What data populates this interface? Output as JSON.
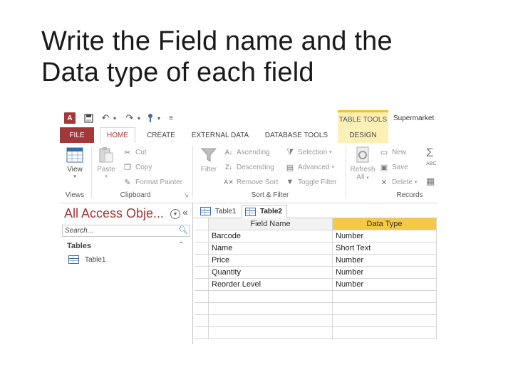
{
  "slide": {
    "title_line1": "Write the Field name and the",
    "title_line2": "Data type of each field"
  },
  "window": {
    "app_name": "Supermarket",
    "contextual_tab_group": "TABLE TOOLS",
    "access_logo": "A"
  },
  "tabs": [
    "FILE",
    "HOME",
    "CREATE",
    "EXTERNAL DATA",
    "DATABASE TOOLS",
    "DESIGN"
  ],
  "ribbon": {
    "views": {
      "view_label": "View",
      "group_label": "Views"
    },
    "clipboard": {
      "paste_label": "Paste",
      "cut_label": "Cut",
      "copy_label": "Copy",
      "format_painter_label": "Format Painter",
      "group_label": "Clipboard"
    },
    "sort_filter": {
      "filter_label": "Filter",
      "ascending_label": "Ascending",
      "descending_label": "Descending",
      "remove_sort_label": "Remove Sort",
      "selection_label": "Selection",
      "advanced_label": "Advanced",
      "toggle_filter_label": "Toggle Filter",
      "group_label": "Sort & Filter"
    },
    "records": {
      "refresh_label": "Refresh",
      "refresh_sub": "All",
      "new_label": "New",
      "save_label": "Save",
      "delete_label": "Delete",
      "group_label": "Records"
    }
  },
  "nav_pane": {
    "title": "All Access Obje...",
    "search_placeholder": "Search...",
    "group": "Tables",
    "items": [
      "Table1"
    ]
  },
  "document_tabs": [
    "Table1",
    "Table2"
  ],
  "design_grid": {
    "columns": [
      "Field Name",
      "Data Type"
    ],
    "rows": [
      {
        "field": "Barcode",
        "type": "Number"
      },
      {
        "field": "Name",
        "type": "Short Text"
      },
      {
        "field": "Price",
        "type": "Number"
      },
      {
        "field": "Quantity",
        "type": "Number"
      },
      {
        "field": "Reorder Level",
        "type": "Number"
      },
      {
        "field": "",
        "type": ""
      },
      {
        "field": "",
        "type": ""
      },
      {
        "field": "",
        "type": ""
      },
      {
        "field": "",
        "type": ""
      }
    ]
  },
  "colors": {
    "access_accent": "#a4373a",
    "table_tools_highlight": "#fdf0b6",
    "data_type_header": "#f6c944"
  }
}
